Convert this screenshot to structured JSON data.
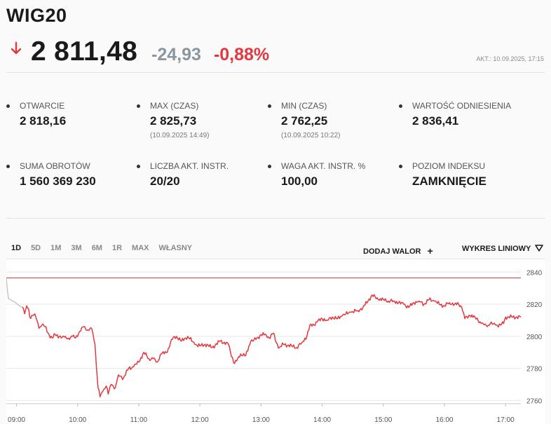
{
  "header": {
    "index_name": "WIG20",
    "price": "2 811,48",
    "change_abs": "-24,93",
    "change_pct": "-0,88%",
    "updated": "AKT.: 10.09.2025, 17:15",
    "trend_icon": "down-arrow-icon",
    "colors": {
      "negative": "#e3383e",
      "muted": "#8a96a0"
    }
  },
  "stats": [
    {
      "label": "OTWARCIE",
      "value": "2 818,16",
      "sub": ""
    },
    {
      "label": "MAX (CZAS)",
      "value": "2 825,73",
      "sub": "(10.09.2025 14:49)"
    },
    {
      "label": "MIN (CZAS)",
      "value": "2 762,25",
      "sub": "(10.09.2025 10:22)"
    },
    {
      "label": "WARTOŚĆ ODNIESIENIA",
      "value": "2 836,41",
      "sub": ""
    },
    {
      "label": "SUMA OBROTÓW",
      "value": "1 560 369 230",
      "sub": ""
    },
    {
      "label": "LICZBA AKT. INSTR.",
      "value": "20/20",
      "sub": ""
    },
    {
      "label": "WAGA AKT. INSTR. %",
      "value": "100,00",
      "sub": ""
    },
    {
      "label": "POZIOM INDEKSU",
      "value": "ZAMKNIĘCIE",
      "sub": ""
    }
  ],
  "controls": {
    "ranges": [
      "1D",
      "5D",
      "1M",
      "3M",
      "6M",
      "1R",
      "MAX",
      "WŁASNY"
    ],
    "active_range": "1D",
    "add_stock_label": "DODAJ WALOR",
    "add_stock_icon": "plus-icon",
    "chart_type_label": "WYKRES LINIOWY",
    "chart_type_icon": "triangle-down-icon"
  },
  "chart_data": {
    "type": "line",
    "x_tick_labels": [
      "09:00",
      "10:00",
      "11:00",
      "12:00",
      "13:00",
      "14:00",
      "15:00",
      "16:00",
      "17:00"
    ],
    "y_tick_labels": [
      "2760",
      "2780",
      "2800",
      "2820",
      "2840"
    ],
    "ylim": [
      2758,
      2848
    ],
    "xlim": [
      "08:50",
      "17:15"
    ],
    "reference_value": 2836.41,
    "reference_color": "#e3383e",
    "line_color": "#e3383e",
    "pre_open_color": "#b8c0c8",
    "grid": true,
    "pre_open_series": [
      [
        "08:50",
        2836.4
      ],
      [
        "08:51",
        2829
      ],
      [
        "08:52",
        2823.5
      ],
      [
        "08:54",
        2823
      ],
      [
        "08:56",
        2822
      ],
      [
        "08:58",
        2821.5
      ],
      [
        "09:00",
        2820.5
      ],
      [
        "09:02",
        2819.5
      ],
      [
        "09:04",
        2818.5
      ],
      [
        "09:06",
        2818
      ]
    ],
    "series": [
      {
        "points": [
          [
            "09:06",
            2818.2
          ],
          [
            "09:08",
            2814
          ],
          [
            "09:10",
            2819
          ],
          [
            "09:12",
            2817
          ],
          [
            "09:13",
            2812
          ],
          [
            "09:15",
            2813
          ],
          [
            "09:18",
            2814
          ],
          [
            "09:20",
            2810
          ],
          [
            "09:22",
            2805
          ],
          [
            "09:25",
            2807
          ],
          [
            "09:28",
            2806
          ],
          [
            "09:32",
            2801
          ],
          [
            "09:35",
            2799
          ],
          [
            "09:38",
            2801
          ],
          [
            "09:42",
            2800
          ],
          [
            "09:45",
            2799.5
          ],
          [
            "09:48",
            2800
          ],
          [
            "09:52",
            2798
          ],
          [
            "09:55",
            2800
          ],
          [
            "09:58",
            2799
          ],
          [
            "10:02",
            2803
          ],
          [
            "10:06",
            2806
          ],
          [
            "10:10",
            2804
          ],
          [
            "10:14",
            2804.5
          ],
          [
            "10:17",
            2795
          ],
          [
            "10:18",
            2785
          ],
          [
            "10:20",
            2768
          ],
          [
            "10:22",
            2762.3
          ],
          [
            "10:25",
            2766
          ],
          [
            "10:28",
            2769
          ],
          [
            "10:30",
            2764
          ],
          [
            "10:33",
            2770
          ],
          [
            "10:37",
            2768
          ],
          [
            "10:40",
            2776
          ],
          [
            "10:45",
            2774
          ],
          [
            "10:50",
            2780
          ],
          [
            "10:55",
            2781
          ],
          [
            "11:00",
            2784
          ],
          [
            "11:05",
            2790
          ],
          [
            "11:10",
            2786
          ],
          [
            "11:14",
            2786
          ],
          [
            "11:18",
            2784
          ],
          [
            "11:22",
            2789
          ],
          [
            "11:28",
            2790
          ],
          [
            "11:32",
            2798
          ],
          [
            "11:37",
            2800
          ],
          [
            "11:42",
            2797
          ],
          [
            "11:48",
            2800
          ],
          [
            "11:55",
            2795
          ],
          [
            "12:00",
            2794
          ],
          [
            "12:05",
            2795
          ],
          [
            "12:12",
            2793
          ],
          [
            "12:20",
            2797
          ],
          [
            "12:28",
            2795
          ],
          [
            "12:30",
            2790
          ],
          [
            "12:34",
            2783
          ],
          [
            "12:37",
            2786
          ],
          [
            "12:40",
            2789
          ],
          [
            "12:45",
            2788
          ],
          [
            "12:50",
            2797
          ],
          [
            "12:55",
            2798
          ],
          [
            "13:00",
            2801
          ],
          [
            "13:05",
            2801
          ],
          [
            "13:08",
            2799
          ],
          [
            "13:12",
            2802
          ],
          [
            "13:15",
            2796
          ],
          [
            "13:18",
            2793
          ],
          [
            "13:22",
            2795
          ],
          [
            "13:30",
            2794
          ],
          [
            "13:35",
            2793
          ],
          [
            "13:40",
            2796
          ],
          [
            "13:45",
            2800
          ],
          [
            "13:48",
            2807
          ],
          [
            "13:52",
            2807
          ],
          [
            "13:55",
            2809
          ],
          [
            "14:00",
            2811
          ],
          [
            "14:05",
            2810
          ],
          [
            "14:10",
            2812
          ],
          [
            "14:15",
            2811
          ],
          [
            "14:20",
            2813
          ],
          [
            "14:28",
            2815
          ],
          [
            "14:35",
            2816
          ],
          [
            "14:40",
            2818
          ],
          [
            "14:45",
            2822
          ],
          [
            "14:49",
            2825.7
          ],
          [
            "14:55",
            2823
          ],
          [
            "15:00",
            2823
          ],
          [
            "15:05",
            2822
          ],
          [
            "15:10",
            2822
          ],
          [
            "15:15",
            2821
          ],
          [
            "15:20",
            2820
          ],
          [
            "15:25",
            2818
          ],
          [
            "15:30",
            2821
          ],
          [
            "15:35",
            2822
          ],
          [
            "15:40",
            2820
          ],
          [
            "15:45",
            2823
          ],
          [
            "15:50",
            2822
          ],
          [
            "15:55",
            2820
          ],
          [
            "16:00",
            2819
          ],
          [
            "16:05",
            2821
          ],
          [
            "16:10",
            2820
          ],
          [
            "16:14",
            2820
          ],
          [
            "16:17",
            2818
          ],
          [
            "16:20",
            2811
          ],
          [
            "16:25",
            2813
          ],
          [
            "16:30",
            2812
          ],
          [
            "16:35",
            2809
          ],
          [
            "16:38",
            2808
          ],
          [
            "16:42",
            2806
          ],
          [
            "16:45",
            2808
          ],
          [
            "16:50",
            2807
          ],
          [
            "16:55",
            2807
          ],
          [
            "16:58",
            2808
          ],
          [
            "17:00",
            2812
          ],
          [
            "17:15",
            2812
          ]
        ]
      }
    ]
  }
}
